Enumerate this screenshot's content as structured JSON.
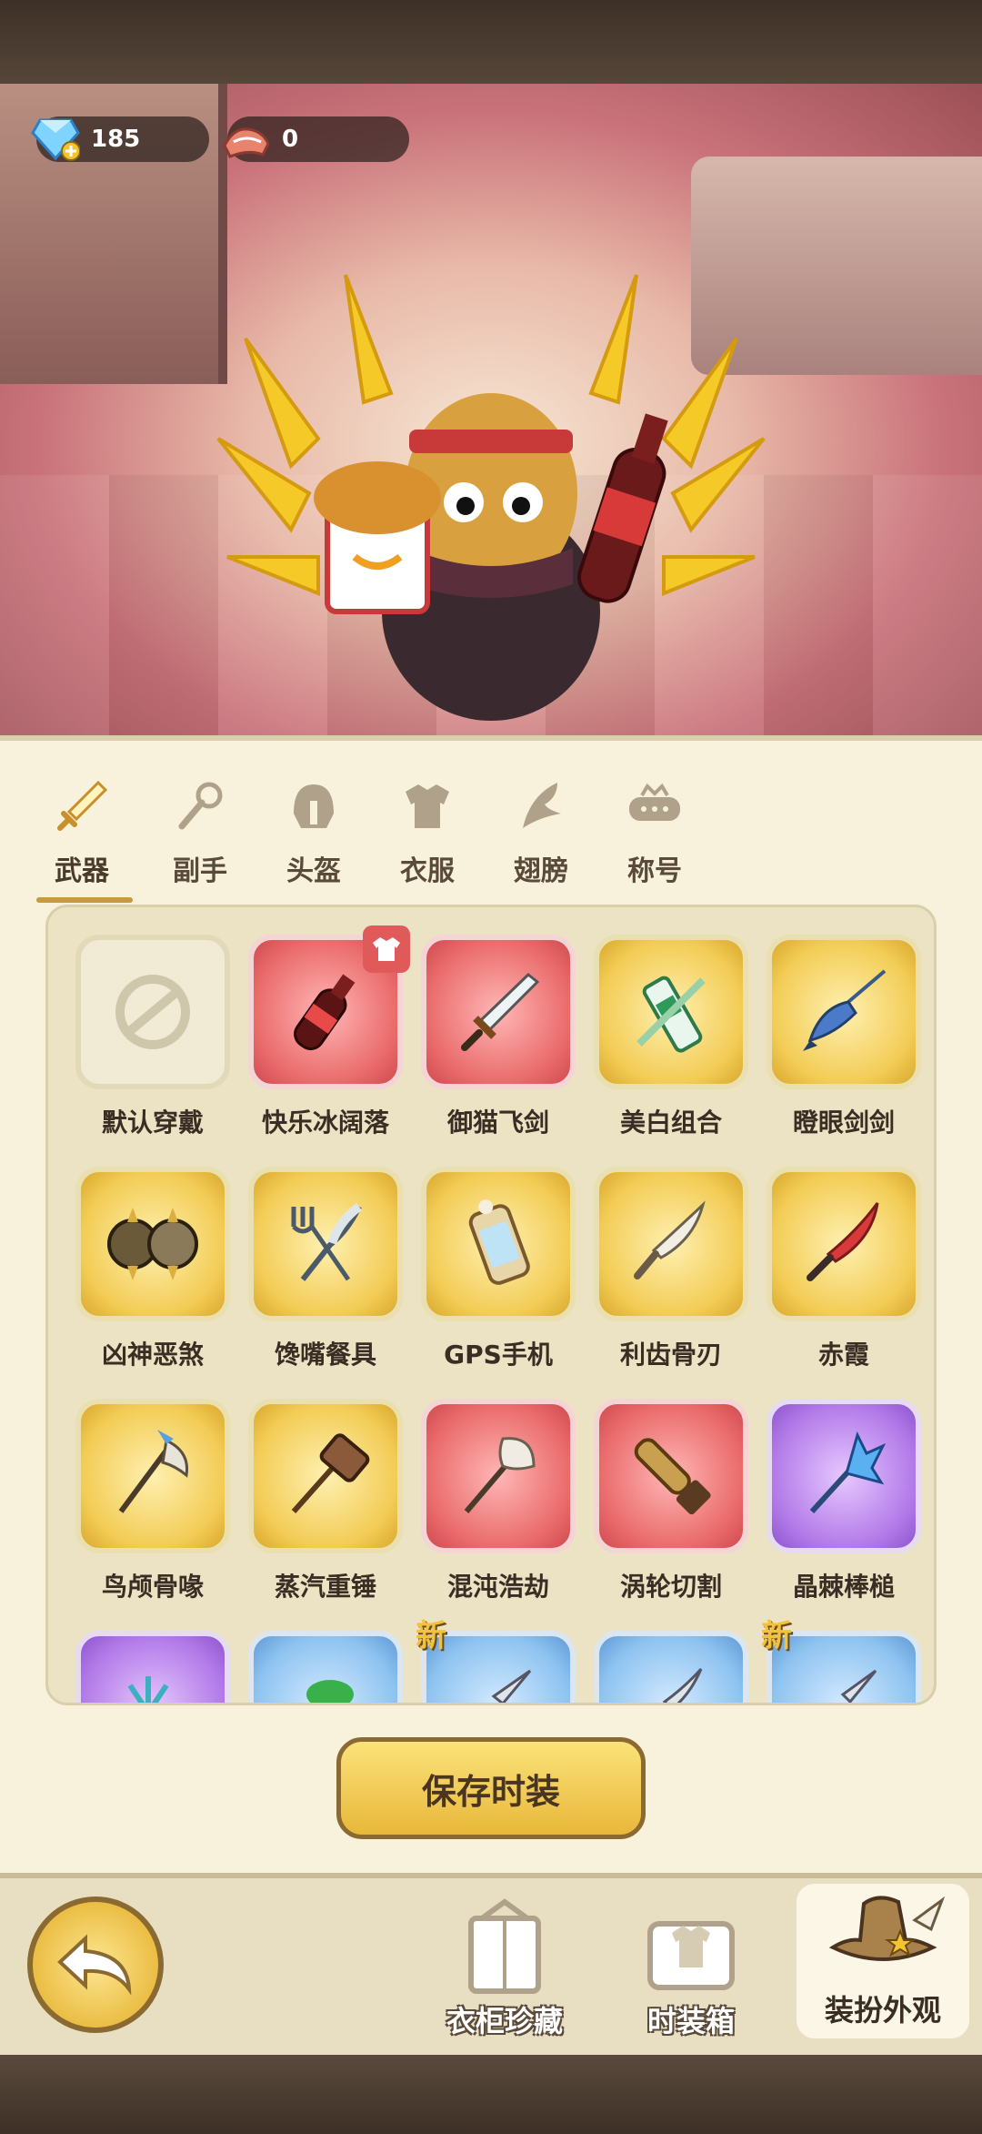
{
  "currency": {
    "gems": "185",
    "cloth": "0"
  },
  "tabs": [
    {
      "label": "武器",
      "icon": "sword-icon",
      "active": true
    },
    {
      "label": "副手",
      "icon": "offhand-icon"
    },
    {
      "label": "头盔",
      "icon": "helmet-icon"
    },
    {
      "label": "衣服",
      "icon": "armor-icon"
    },
    {
      "label": "翅膀",
      "icon": "wings-icon"
    },
    {
      "label": "称号",
      "icon": "title-icon"
    }
  ],
  "items": [
    {
      "label": "默认穿戴",
      "rarity": "none",
      "icon": "no-equip-icon"
    },
    {
      "label": "快乐冰阔落",
      "rarity": "red",
      "icon": "cola-bottle-icon",
      "equipped": true
    },
    {
      "label": "御猫飞剑",
      "rarity": "red",
      "icon": "sword-icon"
    },
    {
      "label": "美白组合",
      "rarity": "gold",
      "icon": "toothpaste-icon"
    },
    {
      "label": "瞪眼剑剑",
      "rarity": "gold",
      "icon": "swordfish-icon"
    },
    {
      "label": "凶神恶煞",
      "rarity": "gold",
      "icon": "spiked-knuckle-icon"
    },
    {
      "label": "馋嘴餐具",
      "rarity": "gold",
      "icon": "fork-knife-icon"
    },
    {
      "label": "GPS手机",
      "rarity": "gold",
      "icon": "phone-icon"
    },
    {
      "label": "利齿骨刃",
      "rarity": "gold",
      "icon": "bone-blade-icon"
    },
    {
      "label": "赤霞",
      "rarity": "gold",
      "icon": "red-blade-icon"
    },
    {
      "label": "鸟颅骨喙",
      "rarity": "gold",
      "icon": "bird-skull-staff-icon"
    },
    {
      "label": "蒸汽重锤",
      "rarity": "gold",
      "icon": "steam-hammer-icon"
    },
    {
      "label": "混沌浩劫",
      "rarity": "red",
      "icon": "chaos-mace-icon"
    },
    {
      "label": "涡轮切割",
      "rarity": "red",
      "icon": "chainsaw-icon"
    },
    {
      "label": "晶棘棒槌",
      "rarity": "purple",
      "icon": "crystal-club-icon"
    },
    {
      "label": "",
      "rarity": "purple",
      "icon": "trident-icon"
    },
    {
      "label": "",
      "rarity": "blue",
      "icon": "leaf-weapon-icon"
    },
    {
      "label": "",
      "rarity": "blue",
      "icon": "knife-icon",
      "badge": "新"
    },
    {
      "label": "",
      "rarity": "blue",
      "icon": "curved-blade-icon"
    },
    {
      "label": "",
      "rarity": "blue",
      "icon": "dagger-icon",
      "badge": "新"
    }
  ],
  "save_button": "保存时装",
  "bottom_nav": {
    "wardrobe": "衣柜珍藏",
    "fashion_box": "时装箱",
    "dress_up": "装扮外观"
  }
}
